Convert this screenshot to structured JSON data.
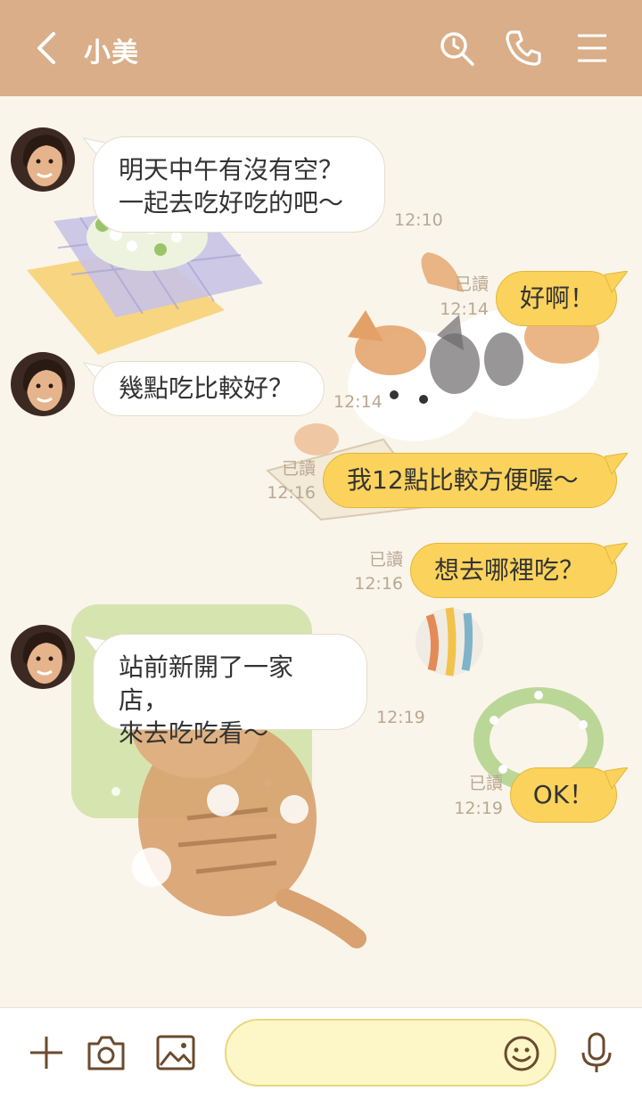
{
  "header": {
    "title": "小美"
  },
  "messages": [
    {
      "side": "in",
      "lines": [
        "明天中午有沒有空？",
        "一起去吃好吃的吧～"
      ],
      "time": "12:10"
    },
    {
      "side": "out",
      "text": "好啊！",
      "read": "已讀",
      "time": "12:14"
    },
    {
      "side": "in",
      "lines": [
        "幾點吃比較好？"
      ],
      "time": "12:14"
    },
    {
      "side": "out",
      "text": "我12點比較方便喔～",
      "read": "已讀",
      "time": "12:16"
    },
    {
      "side": "out",
      "text": "想去哪裡吃？",
      "read": "已讀",
      "time": "12:16"
    },
    {
      "side": "in",
      "lines": [
        "站前新開了一家店，",
        "來去吃吃看～"
      ],
      "time": "12:19"
    },
    {
      "side": "out",
      "text": "OK！",
      "read": "已讀",
      "time": "12:19"
    }
  ],
  "colors": {
    "header": "#d9ae88",
    "outgoing_bubble": "#fbd35c",
    "background": "#faf5ea"
  }
}
